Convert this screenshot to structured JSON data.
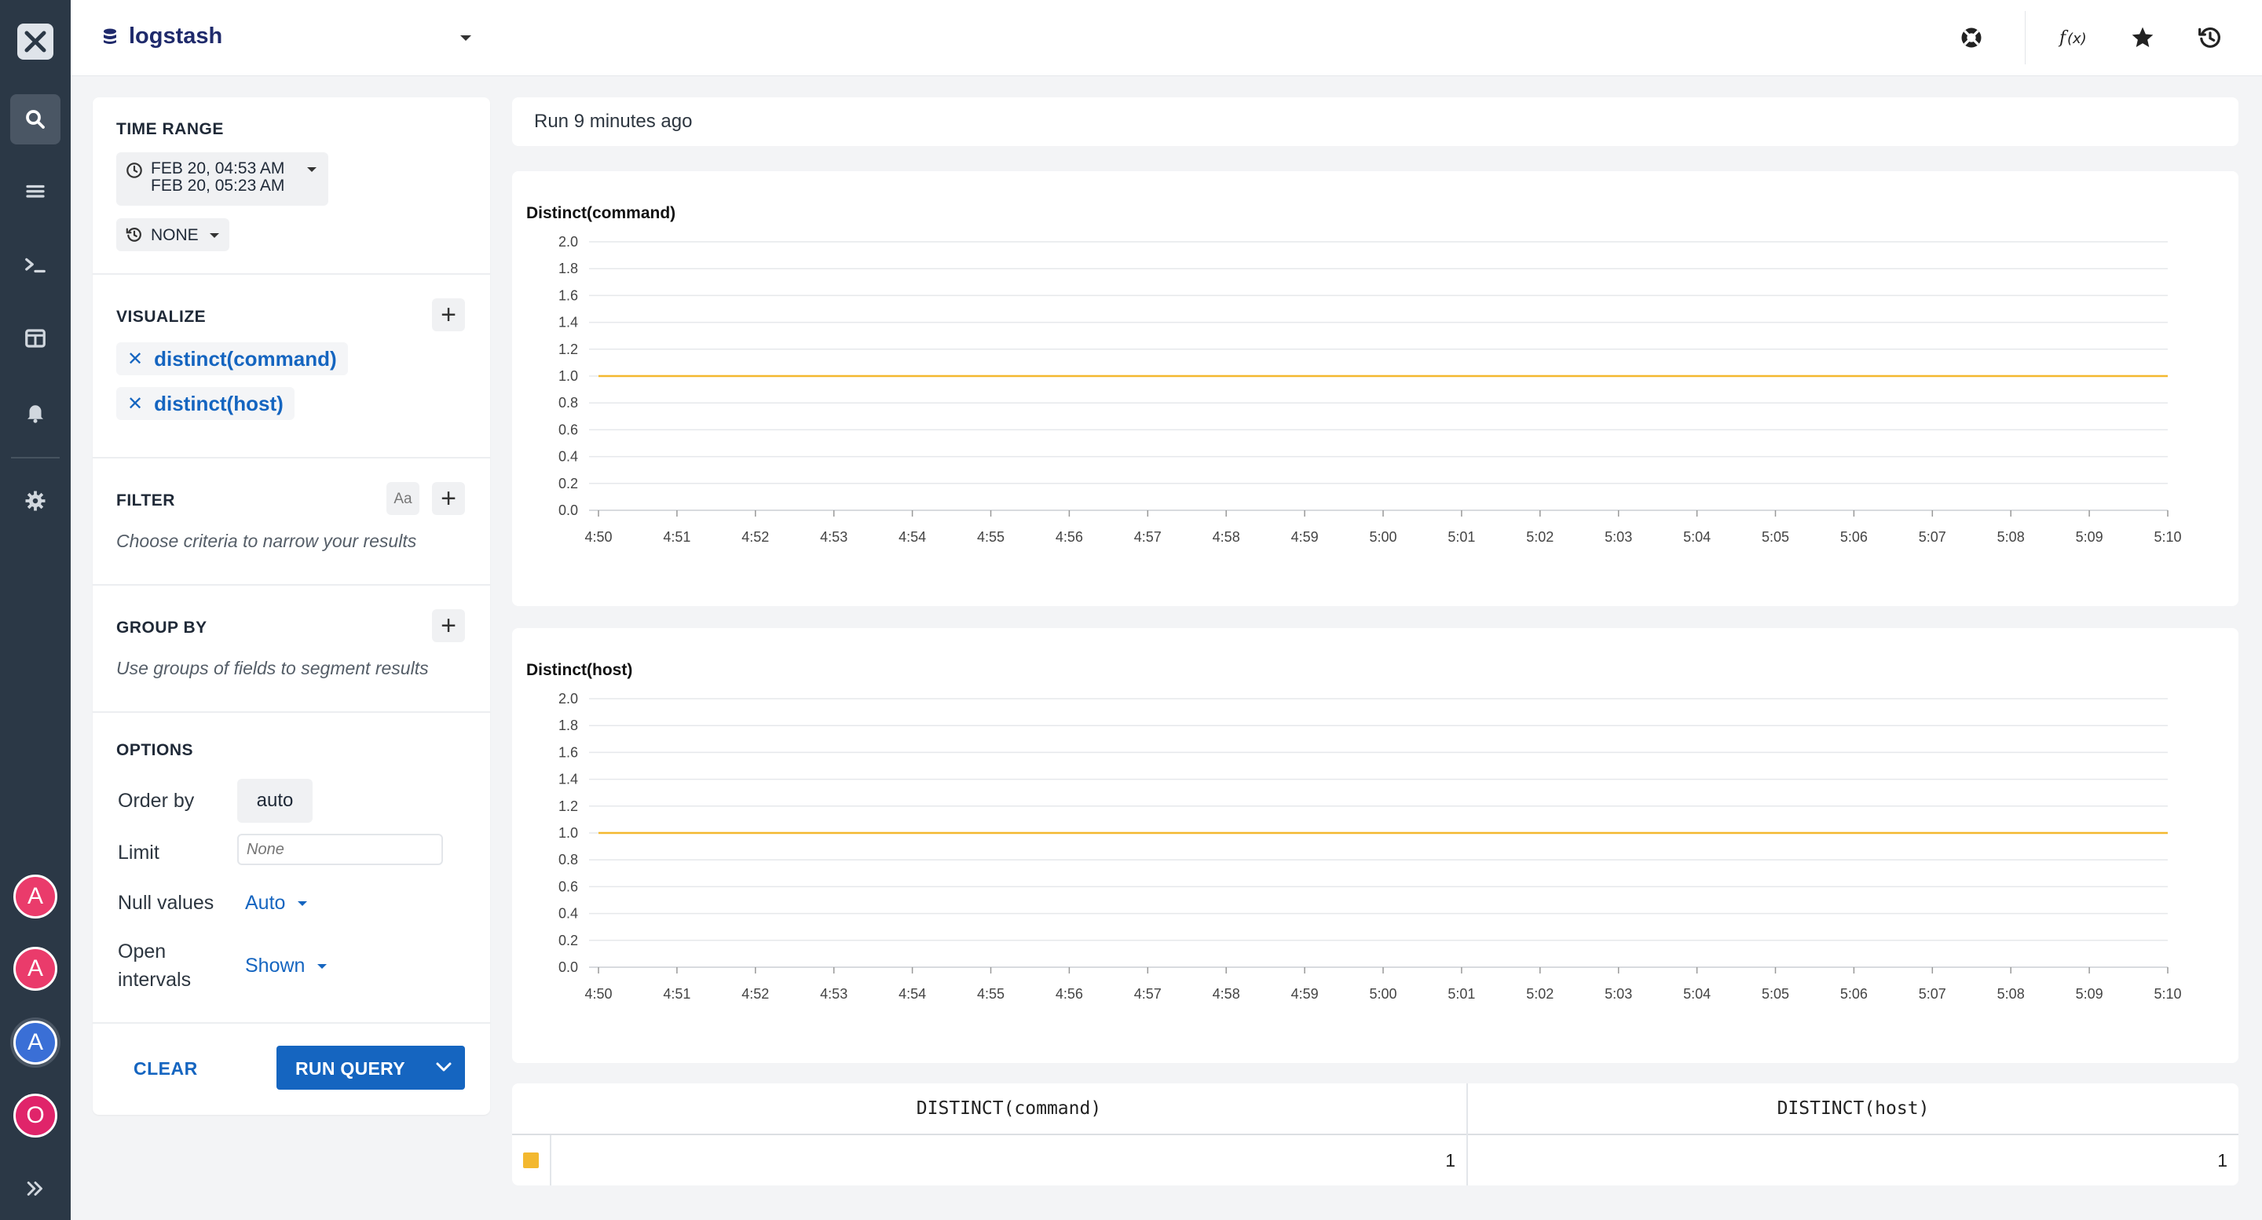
{
  "app": {
    "dataset_name": "logstash"
  },
  "sidebar": {
    "avatars": [
      {
        "letter": "A",
        "color": "#ea3b6b"
      },
      {
        "letter": "A",
        "color": "#ea3b6b"
      },
      {
        "letter": "A",
        "color": "#3a6fd6"
      },
      {
        "letter": "O",
        "color": "#e0246a"
      }
    ]
  },
  "query": {
    "time_range": {
      "title": "TIME RANGE",
      "from": "FEB 20, 04:53 AM",
      "to": "FEB 20, 05:23 AM",
      "compare": "NONE"
    },
    "visualize": {
      "title": "VISUALIZE",
      "items": [
        "distinct(command)",
        "distinct(host)"
      ]
    },
    "filter": {
      "title": "FILTER",
      "case_label": "Aa",
      "hint": "Choose criteria to narrow your results"
    },
    "group_by": {
      "title": "GROUP BY",
      "hint": "Use groups of fields to segment results"
    },
    "options": {
      "title": "OPTIONS",
      "order_by_label": "Order by",
      "order_by_value": "auto",
      "limit_label": "Limit",
      "limit_placeholder": "None",
      "null_values_label": "Null values",
      "null_values_value": "Auto",
      "open_intervals_label_1": "Open",
      "open_intervals_label_2": "intervals",
      "open_intervals_value": "Shown"
    },
    "actions": {
      "clear": "CLEAR",
      "run": "RUN QUERY"
    }
  },
  "results": {
    "status": "Run 9 minutes ago",
    "table": {
      "headers": [
        "DISTINCT(command)",
        "DISTINCT(host)"
      ],
      "rows": [
        [
          "1",
          "1"
        ]
      ],
      "swatch_color": "#f3b82f"
    }
  },
  "chart_data": [
    {
      "type": "line",
      "title": "Distinct(command)",
      "x": [
        "4:50",
        "4:51",
        "4:52",
        "4:53",
        "4:54",
        "4:55",
        "4:56",
        "4:57",
        "4:58",
        "4:59",
        "5:00",
        "5:01",
        "5:02",
        "5:03",
        "5:04",
        "5:05",
        "5:06",
        "5:07",
        "5:08",
        "5:09",
        "5:10"
      ],
      "y_ticks": [
        "2.0",
        "1.8",
        "1.6",
        "1.4",
        "1.2",
        "1.0",
        "0.8",
        "0.6",
        "0.4",
        "0.2",
        "0.0"
      ],
      "ylim": [
        0,
        2
      ],
      "series": [
        {
          "values": [
            1,
            1,
            1,
            1,
            1,
            1,
            1,
            1,
            1,
            1,
            1,
            1,
            1,
            1,
            1,
            1,
            1,
            1,
            1,
            1,
            1
          ],
          "color": "#f3b82f"
        }
      ],
      "grid": true
    },
    {
      "type": "line",
      "title": "Distinct(host)",
      "x": [
        "4:50",
        "4:51",
        "4:52",
        "4:53",
        "4:54",
        "4:55",
        "4:56",
        "4:57",
        "4:58",
        "4:59",
        "5:00",
        "5:01",
        "5:02",
        "5:03",
        "5:04",
        "5:05",
        "5:06",
        "5:07",
        "5:08",
        "5:09",
        "5:10"
      ],
      "y_ticks": [
        "2.0",
        "1.8",
        "1.6",
        "1.4",
        "1.2",
        "1.0",
        "0.8",
        "0.6",
        "0.4",
        "0.2",
        "0.0"
      ],
      "ylim": [
        0,
        2
      ],
      "series": [
        {
          "values": [
            1,
            1,
            1,
            1,
            1,
            1,
            1,
            1,
            1,
            1,
            1,
            1,
            1,
            1,
            1,
            1,
            1,
            1,
            1,
            1,
            1
          ],
          "color": "#f3b82f"
        }
      ],
      "grid": true
    }
  ]
}
